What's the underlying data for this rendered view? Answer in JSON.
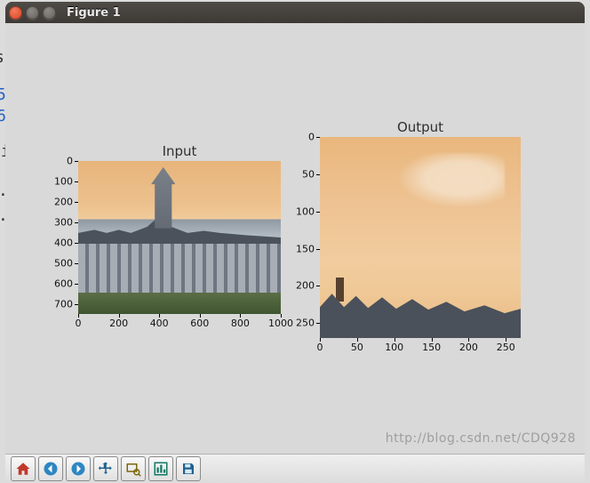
{
  "window": {
    "title": "Figure 1"
  },
  "watermark": "http://blog.csdn.net/CDQ928",
  "toolbar": {
    "home": "home-icon",
    "back": "arrow-left-icon",
    "forward": "arrow-right-icon",
    "pan": "move-icon",
    "zoom": "zoom-rect-icon",
    "config": "subplot-config-icon",
    "save": "save-icon"
  },
  "chart_data": [
    {
      "type": "image",
      "title": "Input",
      "description": "Photograph of a large gothic-style collegiate building with a central spired tower, slate roofs with dormers, a long arcaded stone facade, and a green lawn in the foreground, under an orange/peach sky.",
      "image_extent_x": [
        0,
        1000
      ],
      "image_extent_y": [
        0,
        750
      ],
      "y_inverted": true,
      "xticks": [
        0,
        200,
        400,
        600,
        800,
        1000
      ],
      "yticks": [
        0,
        100,
        200,
        300,
        400,
        500,
        600,
        700
      ],
      "xlabel": "",
      "ylabel": ""
    },
    {
      "type": "image",
      "title": "Output",
      "description": "Cropped / resized top-left region of the same scene: mostly orange sky with a faint cloud, and the dark roofline with repeating gables and a small chimney along the bottom edge.",
      "image_extent_x": [
        0,
        270
      ],
      "image_extent_y": [
        0,
        270
      ],
      "y_inverted": true,
      "xticks": [
        0,
        50,
        100,
        150,
        200,
        250
      ],
      "yticks": [
        0,
        50,
        100,
        150,
        200,
        250
      ],
      "xlabel": "",
      "ylabel": ""
    }
  ]
}
